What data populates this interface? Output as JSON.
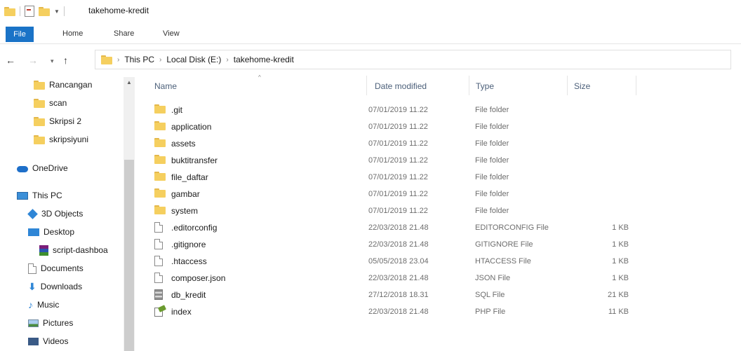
{
  "window": {
    "title": "takehome-kredit"
  },
  "ribbon": {
    "tabs": [
      "File",
      "Home",
      "Share",
      "View"
    ]
  },
  "address": {
    "path": [
      "This PC",
      "Local Disk (E:)",
      "takehome-kredit"
    ]
  },
  "nav": {
    "items": [
      {
        "label": "Rancangan",
        "icon": "folder-icon"
      },
      {
        "label": "scan",
        "icon": "folder-icon"
      },
      {
        "label": "Skripsi 2",
        "icon": "folder-icon"
      },
      {
        "label": "skripsiyuni",
        "icon": "folder-icon"
      },
      {
        "label": "OneDrive",
        "icon": "onedrive-icon"
      },
      {
        "label": "This PC",
        "icon": "pc-icon"
      },
      {
        "label": "3D Objects",
        "icon": "3d-objects-icon"
      },
      {
        "label": "Desktop",
        "icon": "desktop-icon"
      },
      {
        "label": "script-dashboa",
        "icon": "rar-icon"
      },
      {
        "label": "Documents",
        "icon": "documents-icon"
      },
      {
        "label": "Downloads",
        "icon": "downloads-icon"
      },
      {
        "label": "Music",
        "icon": "music-icon"
      },
      {
        "label": "Pictures",
        "icon": "pictures-icon"
      },
      {
        "label": "Videos",
        "icon": "videos-icon"
      }
    ]
  },
  "columns": {
    "name": "Name",
    "date": "Date modified",
    "type": "Type",
    "size": "Size"
  },
  "files": [
    {
      "name": ".git",
      "date": "07/01/2019 11.22",
      "type": "File folder",
      "size": "",
      "icon": "folder-icon"
    },
    {
      "name": "application",
      "date": "07/01/2019 11.22",
      "type": "File folder",
      "size": "",
      "icon": "folder-icon"
    },
    {
      "name": "assets",
      "date": "07/01/2019 11.22",
      "type": "File folder",
      "size": "",
      "icon": "folder-icon"
    },
    {
      "name": "buktitransfer",
      "date": "07/01/2019 11.22",
      "type": "File folder",
      "size": "",
      "icon": "folder-icon"
    },
    {
      "name": "file_daftar",
      "date": "07/01/2019 11.22",
      "type": "File folder",
      "size": "",
      "icon": "folder-icon"
    },
    {
      "name": "gambar",
      "date": "07/01/2019 11.22",
      "type": "File folder",
      "size": "",
      "icon": "folder-icon"
    },
    {
      "name": "system",
      "date": "07/01/2019 11.22",
      "type": "File folder",
      "size": "",
      "icon": "folder-icon"
    },
    {
      "name": ".editorconfig",
      "date": "22/03/2018 21.48",
      "type": "EDITORCONFIG File",
      "size": "1 KB",
      "icon": "file-icon"
    },
    {
      "name": ".gitignore",
      "date": "22/03/2018 21.48",
      "type": "GITIGNORE File",
      "size": "1 KB",
      "icon": "file-icon"
    },
    {
      "name": ".htaccess",
      "date": "05/05/2018 23.04",
      "type": "HTACCESS File",
      "size": "1 KB",
      "icon": "file-icon"
    },
    {
      "name": "composer.json",
      "date": "22/03/2018 21.48",
      "type": "JSON File",
      "size": "1 KB",
      "icon": "file-icon"
    },
    {
      "name": "db_kredit",
      "date": "27/12/2018 18.31",
      "type": "SQL File",
      "size": "21 KB",
      "icon": "database-icon"
    },
    {
      "name": "index",
      "date": "22/03/2018 21.48",
      "type": "PHP File",
      "size": "11 KB",
      "icon": "php-icon"
    }
  ]
}
